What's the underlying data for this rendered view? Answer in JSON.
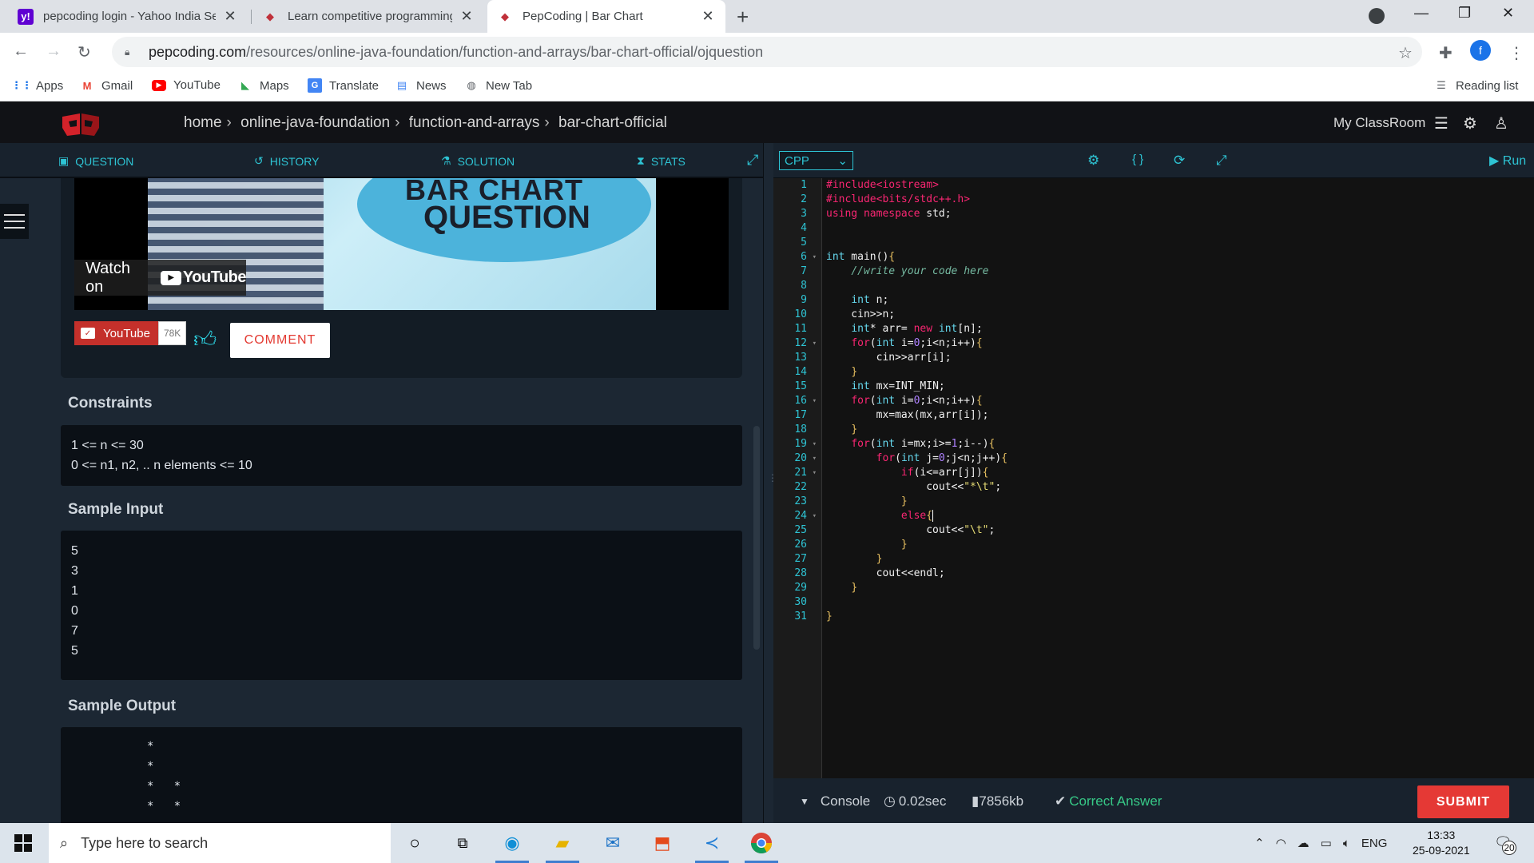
{
  "browser": {
    "tabs": [
      {
        "title": "pepcoding login - Yahoo India Se",
        "icon": "yahoo-icon"
      },
      {
        "title": "Learn competitive programming",
        "icon": "pepcoding-icon"
      },
      {
        "title": "PepCoding | Bar Chart",
        "icon": "pepcoding-icon",
        "active": true
      }
    ],
    "url_host": "pepcoding.com",
    "url_path": "/resources/online-java-foundation/function-and-arrays/bar-chart-official/ojquestion",
    "profile_initial": "f",
    "bookmarks": [
      "Apps",
      "Gmail",
      "YouTube",
      "Maps",
      "Translate",
      "News",
      "New Tab"
    ],
    "reading_list": "Reading list"
  },
  "site": {
    "breadcrumb": [
      "home",
      "online-java-foundation",
      "function-and-arrays",
      "bar-chart-official"
    ],
    "my_classroom": "My ClassRoom"
  },
  "left_tabs": [
    "QUESTION",
    "HISTORY",
    "SOLUTION",
    "STATS"
  ],
  "video": {
    "title_line1": "BAR CHART",
    "title_line2": "QUESTION",
    "watch_on": "Watch on",
    "youtube": "YouTube",
    "subscribe_label": "YouTube",
    "subscriber_count": "78K",
    "comment_button": "COMMENT"
  },
  "constraints": {
    "title": "Constraints",
    "lines": [
      "1 <= n <= 30",
      "0 <= n1, n2, .. n elements <= 10"
    ]
  },
  "sample_input": {
    "title": "Sample Input",
    "lines": [
      "5",
      "3",
      "1",
      "0",
      "7",
      "5"
    ]
  },
  "sample_output": {
    "title": "Sample Output",
    "lines": [
      "*",
      "*",
      "*   *",
      "*   *"
    ]
  },
  "editor": {
    "language": "CPP",
    "run_label": "Run",
    "line_numbers": [
      "1",
      "2",
      "3",
      "4",
      "5",
      "6",
      "7",
      "8",
      "9",
      "10",
      "11",
      "12",
      "13",
      "14",
      "15",
      "16",
      "17",
      "18",
      "19",
      "20",
      "21",
      "22",
      "23",
      "24",
      "25",
      "26",
      "27",
      "28",
      "29",
      "30",
      "31"
    ],
    "folds": [
      "6",
      "12",
      "16",
      "19",
      "20",
      "21",
      "24"
    ]
  },
  "console": {
    "label": "Console",
    "time": "0.02sec",
    "memory": "7856kb",
    "status": "Correct Answer",
    "submit": "SUBMIT"
  },
  "taskbar": {
    "search_placeholder": "Type here to search",
    "language": "ENG",
    "time": "13:33",
    "date": "25-09-2021",
    "notification_count": "20"
  }
}
